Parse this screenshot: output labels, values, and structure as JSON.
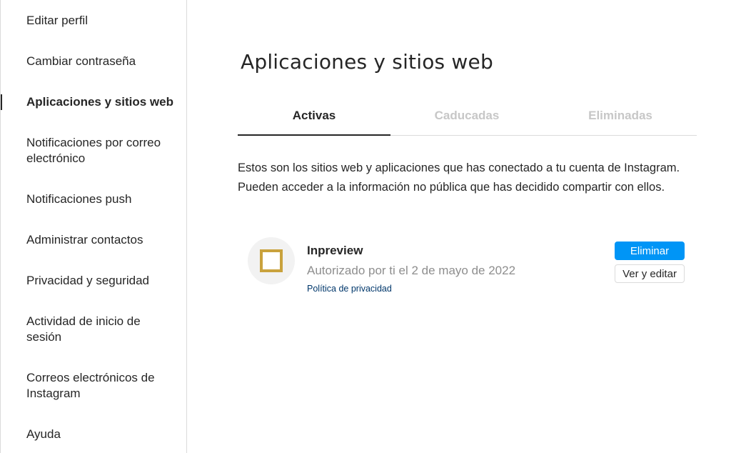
{
  "sidebar": {
    "items": [
      {
        "label": "Editar perfil"
      },
      {
        "label": "Cambiar contraseña"
      },
      {
        "label": "Aplicaciones y sitios web",
        "active": true
      },
      {
        "label": "Notificaciones por correo electrónico"
      },
      {
        "label": "Notificaciones push"
      },
      {
        "label": "Administrar contactos"
      },
      {
        "label": "Privacidad y seguridad"
      },
      {
        "label": "Actividad de inicio de sesión"
      },
      {
        "label": "Correos electrónicos de Instagram"
      },
      {
        "label": "Ayuda"
      }
    ]
  },
  "main": {
    "title": "Aplicaciones y sitios web",
    "tabs": [
      {
        "label": "Activas",
        "active": true
      },
      {
        "label": "Caducadas"
      },
      {
        "label": "Eliminadas"
      }
    ],
    "description": "Estos son los sitios web y aplicaciones que has conectado a tu cuenta de Instagram. Pueden acceder a la información no pública que has decidido compartir con ellos.",
    "app": {
      "icon": "square-logo-icon",
      "name": "Inpreview",
      "authorized": "Autorizado por ti el 2 de mayo de 2022",
      "privacy_link": "Política de privacidad",
      "remove_label": "Eliminar",
      "edit_label": "Ver y editar"
    }
  },
  "colors": {
    "accent": "#0095f6",
    "logo": "#c9a23d",
    "inactive_tab": "#c7c7c7",
    "muted_text": "#8e8e8e",
    "link": "#00376b"
  }
}
